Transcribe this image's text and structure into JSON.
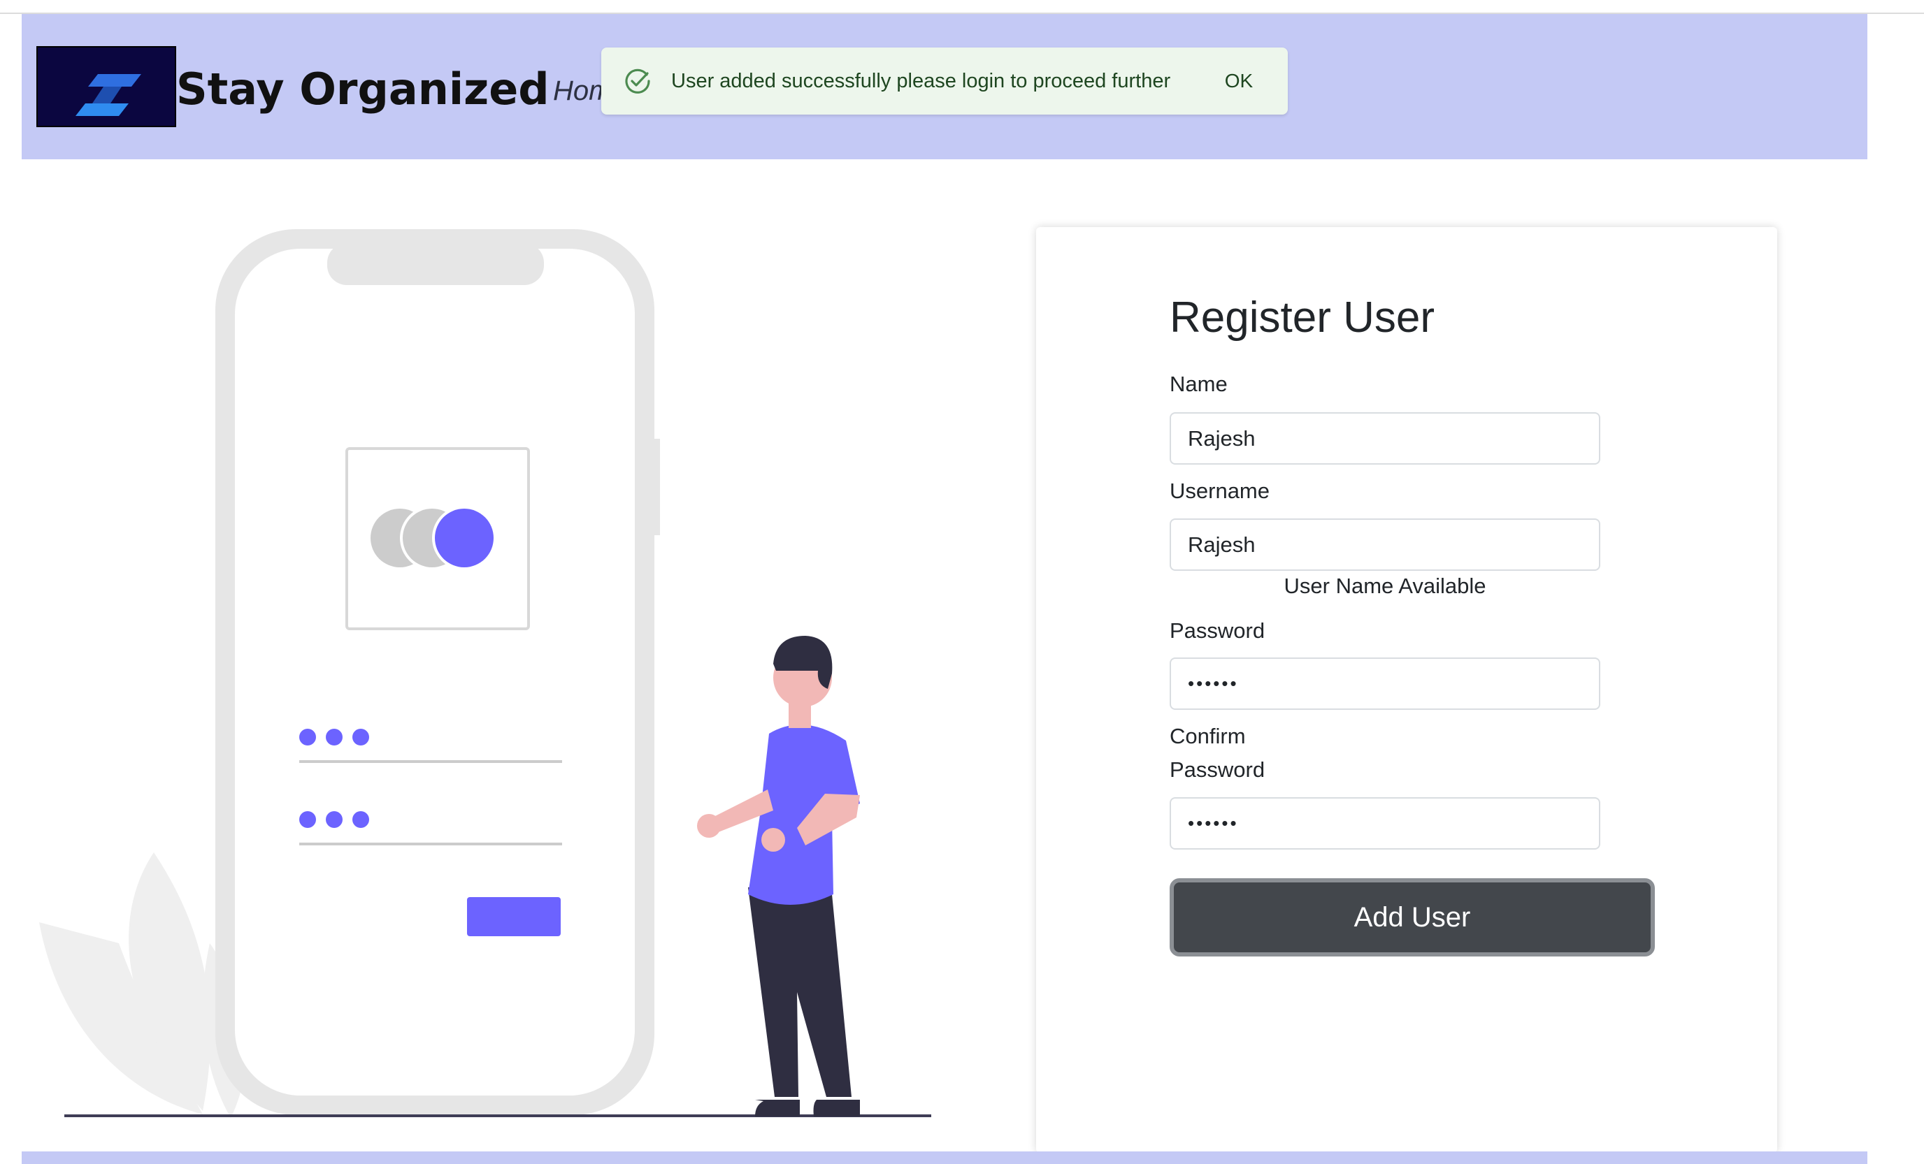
{
  "header": {
    "brand": "Stay Organized",
    "nav_home": "Home"
  },
  "snackbar": {
    "message": "User added successfully please login to proceed further",
    "action_label": "OK"
  },
  "form": {
    "title": "Register User",
    "name_label": "Name",
    "name_value": "Rajesh",
    "username_label": "Username",
    "username_value": "Rajesh",
    "username_status": "User Name Available",
    "password_label": "Password",
    "password_value": "••••••",
    "confirm_label_line1": "Confirm",
    "confirm_label_line2": "Password",
    "confirm_value": "••••••",
    "submit_label": "Add User"
  },
  "colors": {
    "header_bg": "#c4c9f5",
    "accent": "#6c63ff",
    "snackbar_bg": "#edf6ec",
    "button_bg": "#43474c"
  }
}
